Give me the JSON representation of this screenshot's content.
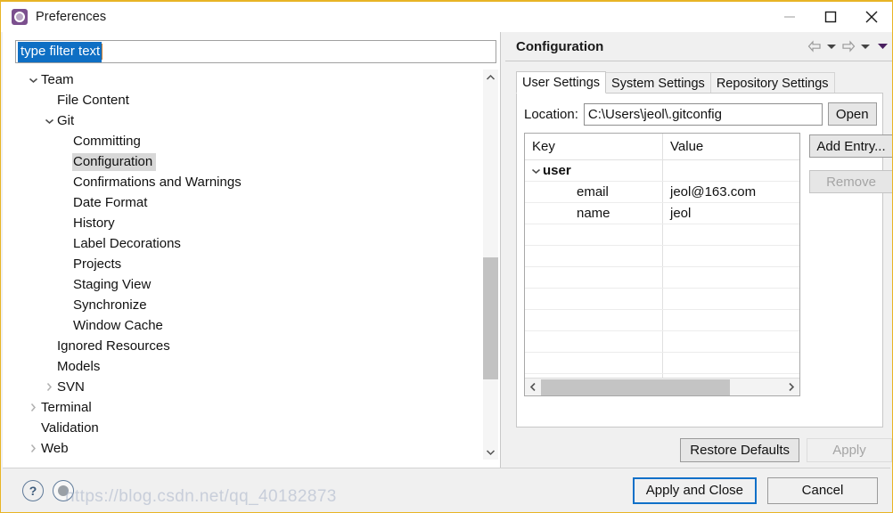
{
  "window": {
    "title": "Preferences",
    "icon": "preferences-gear-icon",
    "border_color": "#e8b425",
    "controls": {
      "minimize": "minimize-icon",
      "maximize": "maximize-icon",
      "close": "close-icon"
    }
  },
  "filter": {
    "value": "type filter text",
    "placeholder": "type filter text",
    "selected": true,
    "selection_color": "#0e6fc4"
  },
  "tree": {
    "items": [
      {
        "label": "Team",
        "indent": 0,
        "twisty": "expanded",
        "selected": false
      },
      {
        "label": "File Content",
        "indent": 1,
        "twisty": "none",
        "selected": false
      },
      {
        "label": "Git",
        "indent": 1,
        "twisty": "expanded",
        "selected": false
      },
      {
        "label": "Committing",
        "indent": 2,
        "twisty": "none",
        "selected": false
      },
      {
        "label": "Configuration",
        "indent": 2,
        "twisty": "none",
        "selected": true
      },
      {
        "label": "Confirmations and Warnings",
        "indent": 2,
        "twisty": "none",
        "selected": false
      },
      {
        "label": "Date Format",
        "indent": 2,
        "twisty": "none",
        "selected": false
      },
      {
        "label": "History",
        "indent": 2,
        "twisty": "none",
        "selected": false
      },
      {
        "label": "Label Decorations",
        "indent": 2,
        "twisty": "none",
        "selected": false
      },
      {
        "label": "Projects",
        "indent": 2,
        "twisty": "none",
        "selected": false
      },
      {
        "label": "Staging View",
        "indent": 2,
        "twisty": "none",
        "selected": false
      },
      {
        "label": "Synchronize",
        "indent": 2,
        "twisty": "none",
        "selected": false
      },
      {
        "label": "Window Cache",
        "indent": 2,
        "twisty": "none",
        "selected": false
      },
      {
        "label": "Ignored Resources",
        "indent": 1,
        "twisty": "none",
        "selected": false
      },
      {
        "label": "Models",
        "indent": 1,
        "twisty": "none",
        "selected": false
      },
      {
        "label": "SVN",
        "indent": 1,
        "twisty": "collapsed",
        "selected": false
      },
      {
        "label": "Terminal",
        "indent": 0,
        "twisty": "collapsed",
        "selected": false
      },
      {
        "label": "Validation",
        "indent": 0,
        "twisty": "none",
        "selected": false
      },
      {
        "label": "Web",
        "indent": 0,
        "twisty": "collapsed",
        "selected": false
      }
    ],
    "scrollbar": {
      "up_icon": "chevron-up-icon",
      "down_icon": "chevron-down-icon",
      "thumb_top_pct": 48,
      "thumb_height_pct": 34
    }
  },
  "page": {
    "title": "Configuration",
    "nav": [
      {
        "icon": "back-arrow-icon"
      },
      {
        "icon": "chevron-down-icon"
      },
      {
        "icon": "forward-arrow-icon"
      },
      {
        "icon": "chevron-down-icon"
      },
      {
        "icon": "view-menu-chevron-down-icon"
      }
    ],
    "tabs": [
      {
        "label": "User Settings",
        "active": true
      },
      {
        "label": "System Settings",
        "active": false
      },
      {
        "label": "Repository Settings",
        "active": false
      }
    ],
    "location": {
      "label": "Location:",
      "value": "C:\\Users\\jeol\\.gitconfig",
      "open_label": "Open"
    },
    "table": {
      "columns": [
        "Key",
        "Value"
      ],
      "rows": [
        {
          "key": "user",
          "value": "",
          "type": "group",
          "twisty": "expanded"
        },
        {
          "key": "email",
          "value": "jeol@163.com",
          "type": "child",
          "twisty": "none"
        },
        {
          "key": "name",
          "value": "jeol",
          "type": "child",
          "twisty": "none"
        },
        {
          "key": "",
          "value": "",
          "type": "empty",
          "twisty": "none"
        },
        {
          "key": "",
          "value": "",
          "type": "empty",
          "twisty": "none"
        },
        {
          "key": "",
          "value": "",
          "type": "empty",
          "twisty": "none"
        },
        {
          "key": "",
          "value": "",
          "type": "empty",
          "twisty": "none"
        },
        {
          "key": "",
          "value": "",
          "type": "empty",
          "twisty": "none"
        },
        {
          "key": "",
          "value": "",
          "type": "empty",
          "twisty": "none"
        },
        {
          "key": "",
          "value": "",
          "type": "empty",
          "twisty": "none"
        },
        {
          "key": "",
          "value": "",
          "type": "empty",
          "twisty": "none"
        }
      ],
      "hscroll": {
        "left_icon": "chevron-left-icon",
        "right_icon": "chevron-right-icon",
        "thumb_width_pct": 78
      }
    },
    "side_buttons": [
      {
        "label": "Add Entry...",
        "enabled": true
      },
      {
        "label": "Remove",
        "enabled": false
      }
    ],
    "page_buttons": [
      {
        "label": "Restore Defaults",
        "enabled": true
      },
      {
        "label": "Apply",
        "enabled": false
      }
    ]
  },
  "bottom": {
    "help_icon": "help-question-icon",
    "help_glyph": "?",
    "shell_icon": "shell-circle-icon",
    "apply_and_close": "Apply and Close",
    "cancel": "Cancel",
    "focus_color": "#1070c8"
  },
  "watermark": {
    "text": "https://blog.csdn.net/qq_40182873"
  }
}
